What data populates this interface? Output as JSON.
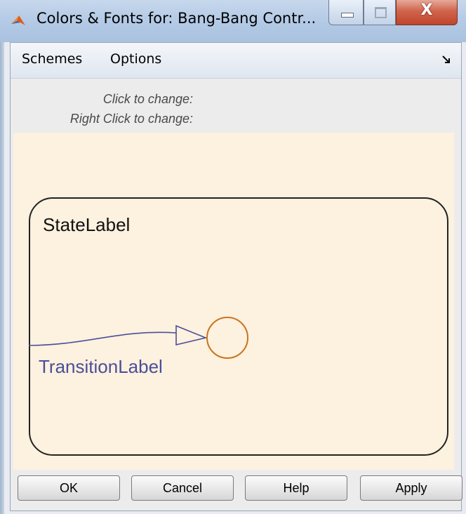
{
  "window": {
    "title": "Colors & Fonts for: Bang-Bang Contr...",
    "close_glyph": "X"
  },
  "menu": {
    "items": [
      "Schemes",
      "Options"
    ]
  },
  "hints": {
    "click": "Click to change:",
    "right_click": "Right Click to change:"
  },
  "preview": {
    "state_label": "StateLabel",
    "transition_label": "TransitionLabel"
  },
  "buttons": {
    "ok": "OK",
    "cancel": "Cancel",
    "help": "Help",
    "apply": "Apply"
  },
  "colors": {
    "canvas_background": "#fdf1df",
    "state_color": "#222222",
    "transition_color": "#4a4f99",
    "junction_color": "#c8741e",
    "title_bar": "#b5cbe6",
    "close_button": "#c0452c"
  },
  "icons": {
    "app": "matlab-logo-icon",
    "minimize": "minimize-icon",
    "maximize": "maximize-icon",
    "close": "close-icon",
    "dock": "dock-arrow-icon"
  }
}
